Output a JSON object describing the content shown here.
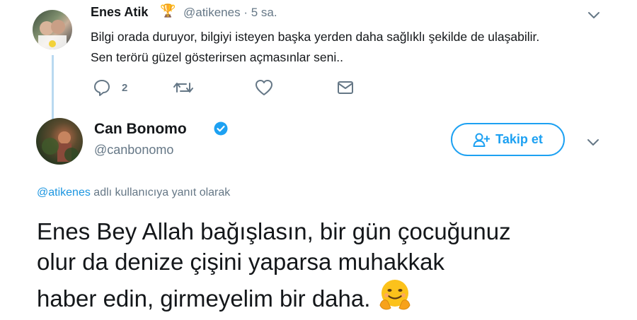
{
  "reply_tweet": {
    "author_name": "Enes Atik",
    "badge_emoji": "🏆",
    "handle": "@atikenes",
    "dot_time": "· 5 sa.",
    "lines": [
      "Bilgi orada duruyor, bilgiyi isteyen başka yerden daha sağlıklı şekilde de ulaşabilir.",
      "Sen terörü güzel gösterirsen açmasınlar seni.."
    ],
    "reply_count": "2",
    "icons": [
      "reply-icon",
      "retweet-icon",
      "like-icon",
      "direct-message-icon",
      "chevron-down-icon"
    ]
  },
  "main_tweet": {
    "author_name": "Can Bonomo",
    "handle": "@canbonomo",
    "follow_label": "Takip et",
    "replying_mention": "@atikenes",
    "replying_suffix": " adlı kullanıcıya yanıt olarak",
    "lines": [
      "Enes Bey Allah bağışlasın, bir gün çocuğunuz",
      "olur da denize çişini yaparsa muhakkak",
      "haber edin, girmeyelim bir daha."
    ],
    "emoji": "hugging-face-emoji",
    "icons": [
      "verified-icon",
      "follow-person-icon",
      "chevron-down-icon"
    ]
  },
  "colors": {
    "brand_blue": "#1da1f2",
    "link_blue": "#1b95e0",
    "muted": "#657786",
    "text": "#14171a",
    "thread_line": "#b9d9f0"
  }
}
